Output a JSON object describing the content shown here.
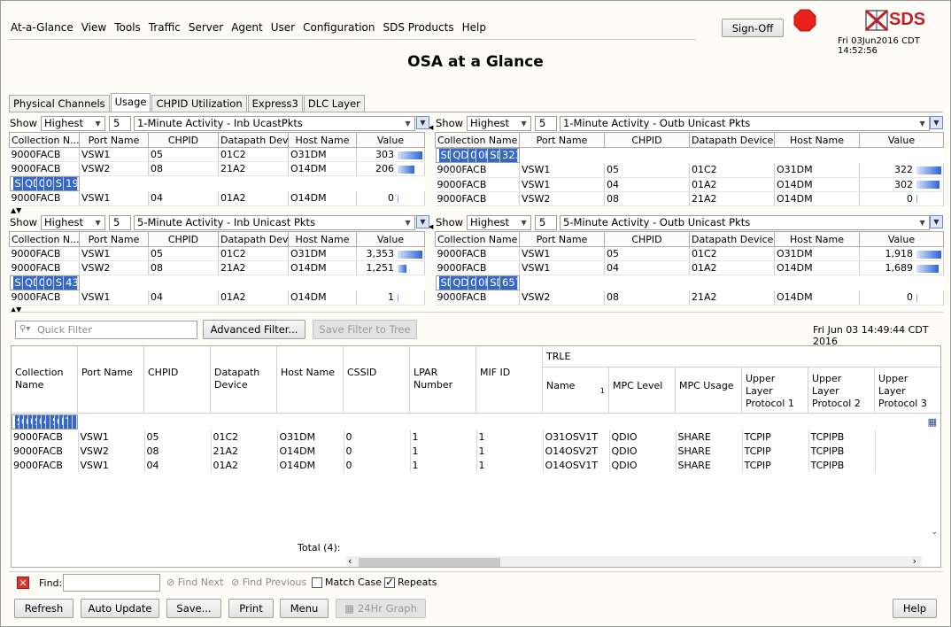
{
  "menu": [
    "At-a-Glance",
    "View",
    "Tools",
    "Traffic",
    "Server",
    "Agent",
    "User",
    "Configuration",
    "SDS Products",
    "Help"
  ],
  "signoff": "Sign-Off",
  "logo_text": "SDS",
  "header_datetime": "Fri 03Jun2016 CDT 14:52:56",
  "page_title": "OSA at a Glance",
  "tabs": [
    "Physical Channels",
    "Usage",
    "CHPID Utilization",
    "Express3",
    "DLC Layer"
  ],
  "colors": {
    "selection": "#3368c8",
    "stop": "#e8211b",
    "logo": "#c0202a"
  },
  "panels": [
    {
      "show": "Show",
      "mode": "Highest",
      "count": "5",
      "metric": "1-Minute Activity - Inb UcastPkts",
      "cols": [
        "Collection N...",
        "Port Name",
        "CHPID",
        "Datapath Dev...",
        "Host Name",
        "Value"
      ],
      "rows": [
        [
          "9000FACB",
          "VSW1",
          "05",
          "01C2",
          "O31DM",
          "303"
        ],
        [
          "9000FACB",
          "VSW2",
          "08",
          "21A2",
          "O14DM",
          "206"
        ],
        [
          "SDS1",
          "QDIOF00",
          "0F",
          "0F02",
          "SDS1",
          "197"
        ],
        [
          "9000FACB",
          "VSW1",
          "04",
          "01A2",
          "O14DM",
          "0"
        ]
      ],
      "fills": [
        1.0,
        0.68,
        0.65,
        0.0
      ],
      "selected": 2
    },
    {
      "show": "Show",
      "mode": "Highest",
      "count": "5",
      "metric": "1-Minute Activity - Outb Unicast Pkts",
      "cols": [
        "Collection Name",
        "Port Name",
        "CHPID",
        "Datapath Device",
        "Host Name",
        "Value"
      ],
      "rows": [
        [
          "SDS1",
          "QDIOF00",
          "0F",
          "0F02",
          "SDS1",
          "323"
        ],
        [
          "9000FACB",
          "VSW1",
          "05",
          "01C2",
          "O31DM",
          "322"
        ],
        [
          "9000FACB",
          "VSW1",
          "04",
          "01A2",
          "O14DM",
          "302"
        ],
        [
          "9000FACB",
          "VSW2",
          "08",
          "21A2",
          "O14DM",
          "0"
        ]
      ],
      "fills": [
        1.0,
        1.0,
        0.94,
        0.0
      ],
      "selected": 0
    },
    {
      "show": "Show",
      "mode": "Highest",
      "count": "5",
      "metric": "5-Minute Activity - Inb Unicast Pkts",
      "cols": [
        "Collection N...",
        "Port Name",
        "CHPID",
        "Datapath Dev...",
        "Host Name",
        "Value"
      ],
      "rows": [
        [
          "9000FACB",
          "VSW1",
          "05",
          "01C2",
          "O31DM",
          "3,353"
        ],
        [
          "9000FACB",
          "VSW2",
          "08",
          "21A2",
          "O14DM",
          "1,251"
        ],
        [
          "SDS1",
          "QDIOF00",
          "0F",
          "0F02",
          "SDS1",
          "434"
        ],
        [
          "9000FACB",
          "VSW1",
          "04",
          "01A2",
          "O14DM",
          "1"
        ]
      ],
      "fills": [
        1.0,
        0.37,
        0.13,
        0.0
      ],
      "selected": 2
    },
    {
      "show": "Show",
      "mode": "Highest",
      "count": "5",
      "metric": "5-Minute Activity - Outb Unicast Pkts",
      "cols": [
        "Collection Name",
        "Port Name",
        "CHPID",
        "Datapath Device",
        "Host Name",
        "Value"
      ],
      "rows": [
        [
          "9000FACB",
          "VSW1",
          "05",
          "01C2",
          "O31DM",
          "1,918"
        ],
        [
          "9000FACB",
          "VSW1",
          "04",
          "01A2",
          "O14DM",
          "1,689"
        ],
        [
          "SDS1",
          "QDIOF00",
          "0F",
          "0F02",
          "SDS1",
          "657"
        ],
        [
          "9000FACB",
          "VSW2",
          "08",
          "21A2",
          "O14DM",
          "0"
        ]
      ],
      "fills": [
        1.0,
        0.88,
        0.34,
        0.0
      ],
      "selected": 2
    }
  ],
  "filter": {
    "placeholder": "Quick Filter",
    "advanced": "Advanced Filter...",
    "save_tree": "Save Filter to Tree",
    "datetime": "Fri Jun 03 14:49:44 CDT 2016"
  },
  "main_table": {
    "headers": [
      "Collection Name",
      "Port Name",
      "CHPID",
      "Datapath Device",
      "Host Name",
      "CSSID",
      "LPAR Number",
      "MIF ID"
    ],
    "group": "TRLE",
    "subheaders": [
      "Name",
      "MPC Level",
      "MPC Usage",
      "Upper Layer Protocol 1",
      "Upper Layer Protocol 2",
      "Upper Layer Protocol 3"
    ],
    "sort_marker": "1",
    "rows": [
      [
        "SDS1",
        "QDIOF00",
        "0F",
        "0F02",
        "SDS1",
        "0",
        "4",
        "",
        "SOMENAME",
        "QDIO",
        "EXCLUSIVE",
        "TCPIP",
        "",
        ""
      ],
      [
        "9000FACB",
        "VSW1",
        "05",
        "01C2",
        "O31DM",
        "0",
        "1",
        "1",
        "O31OSV1T",
        "QDIO",
        "SHARE",
        "TCPIP",
        "TCPIPB",
        ""
      ],
      [
        "9000FACB",
        "VSW2",
        "08",
        "21A2",
        "O14DM",
        "0",
        "1",
        "1",
        "O14OSV2T",
        "QDIO",
        "SHARE",
        "TCPIP",
        "TCPIPB",
        ""
      ],
      [
        "9000FACB",
        "VSW1",
        "04",
        "01A2",
        "O14DM",
        "0",
        "1",
        "1",
        "O14OSV1T",
        "QDIO",
        "SHARE",
        "TCPIP",
        "TCPIPB",
        ""
      ]
    ],
    "selected": 0,
    "total": "Total  (4):"
  },
  "find": {
    "label": "Find:",
    "next": "Find Next",
    "previous": "Find Previous",
    "match_case": "Match Case",
    "repeats": "Repeats",
    "repeats_checked": true,
    "match_checked": false
  },
  "buttons": {
    "refresh": "Refresh",
    "auto_update": "Auto Update",
    "save": "Save...",
    "print": "Print",
    "menu": "Menu",
    "graph": "24Hr Graph",
    "help": "Help"
  }
}
